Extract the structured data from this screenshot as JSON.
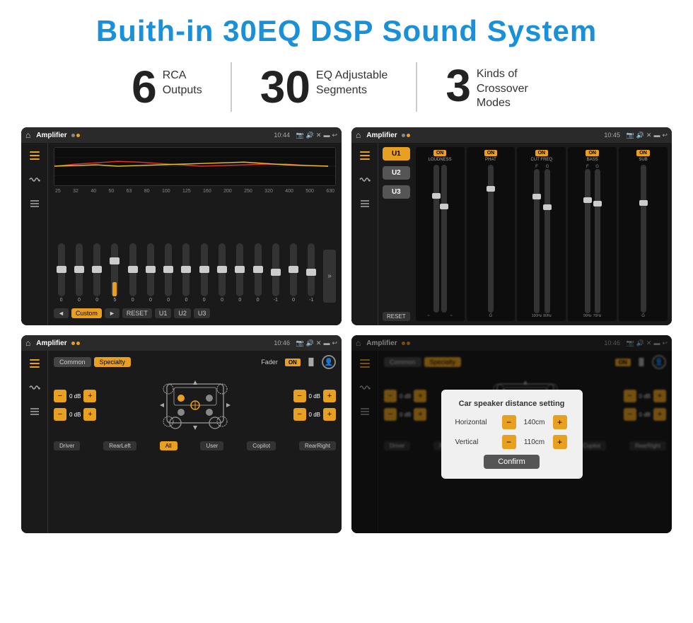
{
  "title": "Buith-in 30EQ DSP Sound System",
  "stats": [
    {
      "number": "6",
      "label_line1": "RCA",
      "label_line2": "Outputs"
    },
    {
      "number": "30",
      "label_line1": "EQ Adjustable",
      "label_line2": "Segments"
    },
    {
      "number": "3",
      "label_line1": "Kinds of",
      "label_line2": "Crossover Modes"
    }
  ],
  "screens": [
    {
      "id": "eq-screen",
      "status_bar": {
        "title": "Amplifier",
        "time": "10:44"
      },
      "type": "eq",
      "freqs": [
        "25",
        "32",
        "40",
        "50",
        "63",
        "80",
        "100",
        "125",
        "160",
        "200",
        "250",
        "320",
        "400",
        "500",
        "630"
      ],
      "values": [
        "0",
        "0",
        "0",
        "5",
        "0",
        "0",
        "0",
        "0",
        "0",
        "0",
        "0",
        "0",
        "-1",
        "0",
        "-1"
      ],
      "bottom_btns": [
        "◄",
        "Custom",
        "►",
        "RESET",
        "U1",
        "U2",
        "U3"
      ]
    },
    {
      "id": "crossover-screen",
      "status_bar": {
        "title": "Amplifier",
        "time": "10:45"
      },
      "type": "crossover",
      "u_btns": [
        "U1",
        "U2",
        "U3"
      ],
      "panels": [
        {
          "on": true,
          "label": "LOUDNESS"
        },
        {
          "on": true,
          "label": "PHAT"
        },
        {
          "on": true,
          "label": "CUT FREQ"
        },
        {
          "on": true,
          "label": "BASS"
        },
        {
          "on": true,
          "label": "SUB"
        }
      ],
      "bottom_btn": "RESET"
    },
    {
      "id": "fader-screen",
      "status_bar": {
        "title": "Amplifier",
        "time": "10:46"
      },
      "type": "fader",
      "tabs": [
        "Common",
        "Specialty"
      ],
      "fader_label": "Fader",
      "on_label": "ON",
      "vol_rows_left": [
        {
          "val": "0 dB"
        },
        {
          "val": "0 dB"
        }
      ],
      "vol_rows_right": [
        {
          "val": "0 dB"
        },
        {
          "val": "0 dB"
        }
      ],
      "bottom_btns": [
        "Driver",
        "RearLeft",
        "All",
        "User",
        "Copilot",
        "RearRight"
      ]
    },
    {
      "id": "distance-screen",
      "status_bar": {
        "title": "Amplifier",
        "time": "10:46"
      },
      "type": "fader-dialog",
      "tabs": [
        "Common",
        "Specialty"
      ],
      "dialog": {
        "title": "Car speaker distance setting",
        "rows": [
          {
            "label": "Horizontal",
            "value": "140cm"
          },
          {
            "label": "Vertical",
            "value": "110cm"
          }
        ],
        "confirm_btn": "Confirm"
      },
      "vol_rows_left": [
        {
          "val": "0 dB"
        },
        {
          "val": "0 dB"
        }
      ],
      "vol_rows_right": [
        {
          "val": "0 dB"
        },
        {
          "val": "0 dB"
        }
      ],
      "bottom_btns": [
        "Driver",
        "RearLeft",
        "All",
        "User",
        "Copilot",
        "RearRight"
      ]
    }
  ],
  "icons": {
    "home": "⌂",
    "play": "▶",
    "back": "↩",
    "location": "📍",
    "camera": "📷",
    "speaker": "🔊",
    "close": "✕",
    "rect": "▬",
    "filter": "⊞",
    "eq": "≡",
    "wave": "∿",
    "arrows": "⇔"
  }
}
